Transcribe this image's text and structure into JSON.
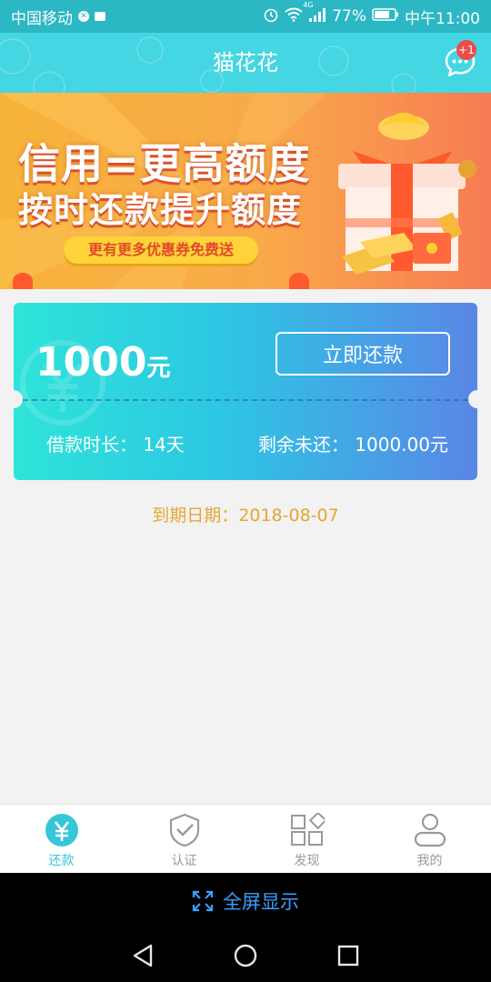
{
  "status_bar": {
    "carrier": "中国移动",
    "network": "4G",
    "battery": "77%",
    "time": "中午11:00"
  },
  "header": {
    "title": "猫花花",
    "message_badge": "+1"
  },
  "banner": {
    "line1": "信用=更高额度",
    "line2": "按时还款提升额度",
    "pill": "更有更多优惠券免费送"
  },
  "card": {
    "amount": "1000",
    "amount_unit": "元",
    "repay_button": "立即还款",
    "duration": "借款时长： 14天",
    "remaining": "剩余未还： 1000.00元"
  },
  "due_date": "到期日期：2018-08-07",
  "tabs": [
    {
      "label": "还款",
      "icon": "yen-icon",
      "active": true
    },
    {
      "label": "认证",
      "icon": "shield-check-icon",
      "active": false
    },
    {
      "label": "发现",
      "icon": "grid-icon",
      "active": false
    },
    {
      "label": "我的",
      "icon": "user-icon",
      "active": false
    }
  ],
  "fullscreen_label": "全屏显示",
  "colors": {
    "primary": "#44d6e2",
    "status_bar": "#2bb7c4",
    "due_text": "#e7a532",
    "fullscreen_text": "#3aa0ff"
  }
}
